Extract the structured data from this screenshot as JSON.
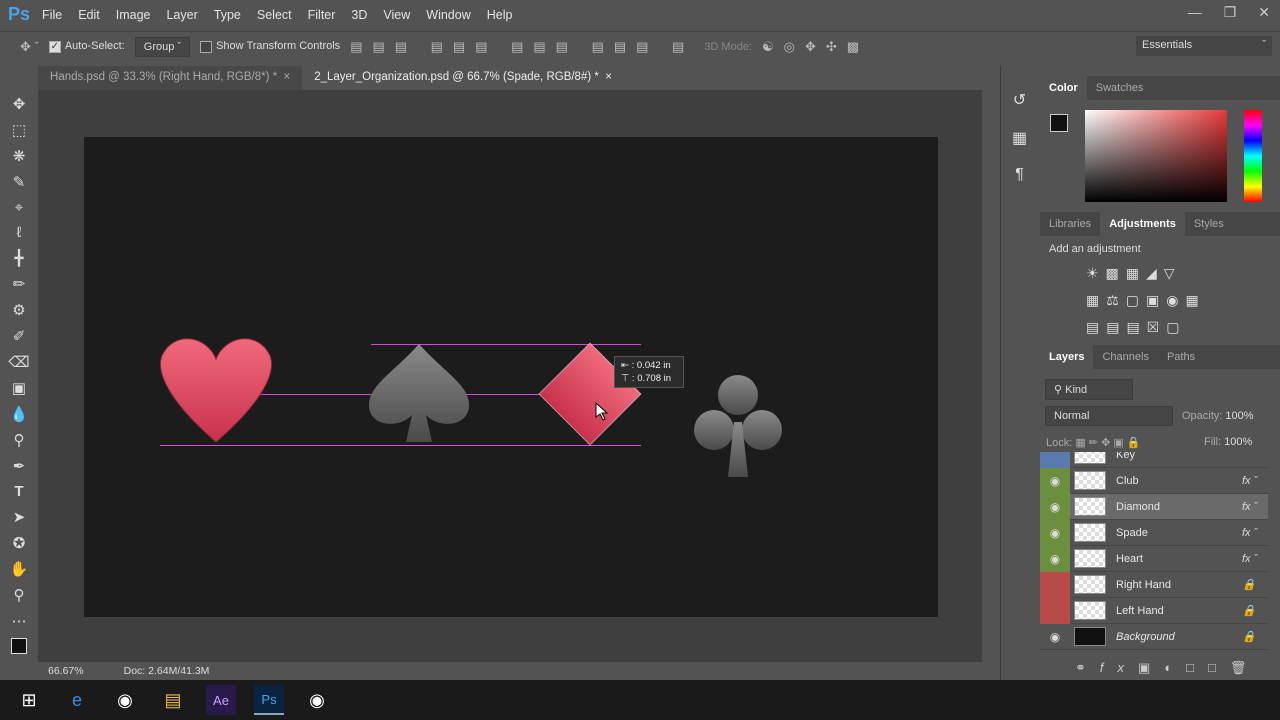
{
  "app": {
    "logo": "Ps",
    "menu": [
      "File",
      "Edit",
      "Image",
      "Layer",
      "Type",
      "Select",
      "Filter",
      "3D",
      "View",
      "Window",
      "Help"
    ]
  },
  "options": {
    "auto_select_label": "Auto-Select:",
    "auto_select_checked": true,
    "auto_select_value": "Group",
    "show_transform_label": "Show Transform Controls",
    "show_transform_checked": false,
    "mode_3d": "3D Mode:",
    "workspace": "Essentials"
  },
  "tabs": [
    {
      "label": "Hands.psd @ 33.3% (Right Hand, RGB/8*) *",
      "active": false
    },
    {
      "label": "2_Layer_Organization.psd @ 66.7% (Spade, RGB/8#) *",
      "active": true
    }
  ],
  "tooltip": {
    "line1": "0.042 in",
    "line2": "0.708 in"
  },
  "status": {
    "zoom": "66.67%",
    "doc": "Doc: 2.64M/41.3M"
  },
  "color_panel": {
    "tabs": [
      "Color",
      "Swatches"
    ],
    "active": "Color"
  },
  "adjust_panel": {
    "tabs": [
      "Libraries",
      "Adjustments",
      "Styles"
    ],
    "active": "Adjustments",
    "hint": "Add an adjustment"
  },
  "layers_panel": {
    "tabs": [
      "Layers",
      "Channels",
      "Paths"
    ],
    "active": "Layers",
    "filter": "Kind",
    "blend_mode": "Normal",
    "opacity_label": "Opacity:",
    "opacity": "100%",
    "lock_label": "Lock:",
    "fill_label": "Fill:",
    "fill": "100%",
    "layers": [
      {
        "name": "Key",
        "color": "#5a7bb0",
        "visible": false,
        "fx": false
      },
      {
        "name": "Club",
        "color": "#6b8f3e",
        "visible": true,
        "fx": true
      },
      {
        "name": "Diamond",
        "color": "#6b8f3e",
        "visible": true,
        "fx": true,
        "selected": true
      },
      {
        "name": "Spade",
        "color": "#6b8f3e",
        "visible": true,
        "fx": true
      },
      {
        "name": "Heart",
        "color": "#6b8f3e",
        "visible": true,
        "fx": true
      },
      {
        "name": "Right Hand",
        "color": "#b84a4a",
        "visible": false,
        "locked": true
      },
      {
        "name": "Left Hand",
        "color": "#b84a4a",
        "visible": false,
        "locked": true
      },
      {
        "name": "Background",
        "color": "",
        "visible": true,
        "locked": true,
        "italic": true
      }
    ]
  },
  "colors": {
    "heart": "#e8475c",
    "diamond": "#e8475c",
    "guide": "#d04fd0"
  }
}
